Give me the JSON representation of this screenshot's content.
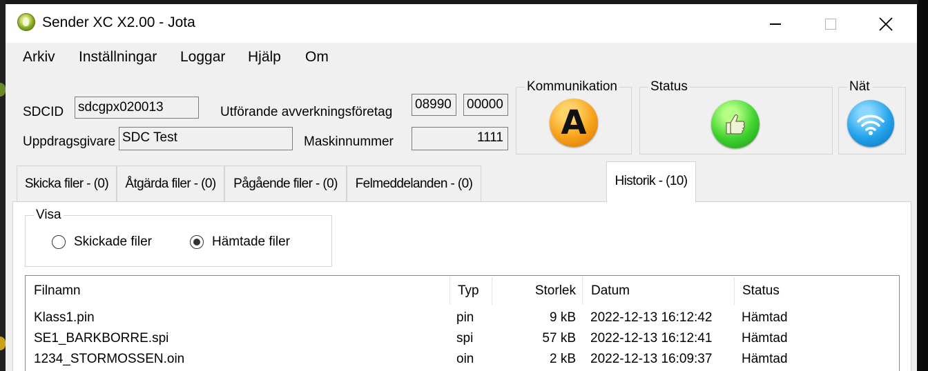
{
  "window": {
    "title": "Sender XC X2.00 - Jota"
  },
  "menu": [
    "Arkiv",
    "Inställningar",
    "Loggar",
    "Hjälp",
    "Om"
  ],
  "form": {
    "sdcid_label": "SDCID",
    "sdcid_value": "sdcgpx020013",
    "company_label": "Utförande avverkningsföretag",
    "company_value_1": "08990",
    "company_value_2": "00000",
    "client_label": "Uppdragsgivare",
    "client_value": "SDC Test",
    "machine_label": "Maskinnummer",
    "machine_value": "1111"
  },
  "indicators": {
    "communication": {
      "title": "Kommunikation",
      "glyph": "A",
      "icon": "orange-a-icon",
      "color": "#f7a21a"
    },
    "status": {
      "title": "Status",
      "icon": "thumbs-up-icon",
      "color": "#3fd22e"
    },
    "network": {
      "title": "Nät",
      "icon": "wifi-icon",
      "color": "#22a2ea"
    }
  },
  "tabs": [
    {
      "label": "Skicka filer - (0)",
      "active": false
    },
    {
      "label": "Åtgärda filer - (0)",
      "active": false
    },
    {
      "label": "Pågående filer - (0)",
      "active": false
    },
    {
      "label": "Felmeddelanden - (0)",
      "active": false
    },
    {
      "label": "Historik - (10)",
      "active": true
    }
  ],
  "history": {
    "view_group_title": "Visa",
    "radio_sent": {
      "label": "Skickade filer",
      "checked": false
    },
    "radio_fetched": {
      "label": "Hämtade filer",
      "checked": true
    },
    "columns": [
      "Filnamn",
      "Typ",
      "Storlek",
      "Datum",
      "Status"
    ],
    "rows": [
      {
        "name": "Klass1.pin",
        "type": "pin",
        "size": "9 kB",
        "date": "2022-12-13 16:12:42",
        "status": "Hämtad"
      },
      {
        "name": "SE1_BARKBORRE.spi",
        "type": "spi",
        "size": "57 kB",
        "date": "2022-12-13 16:12:41",
        "status": "Hämtad"
      },
      {
        "name": "1234_STORMOSSEN.oin",
        "type": "oin",
        "size": "2 kB",
        "date": "2022-12-13 16:09:37",
        "status": "Hämtad"
      }
    ]
  }
}
